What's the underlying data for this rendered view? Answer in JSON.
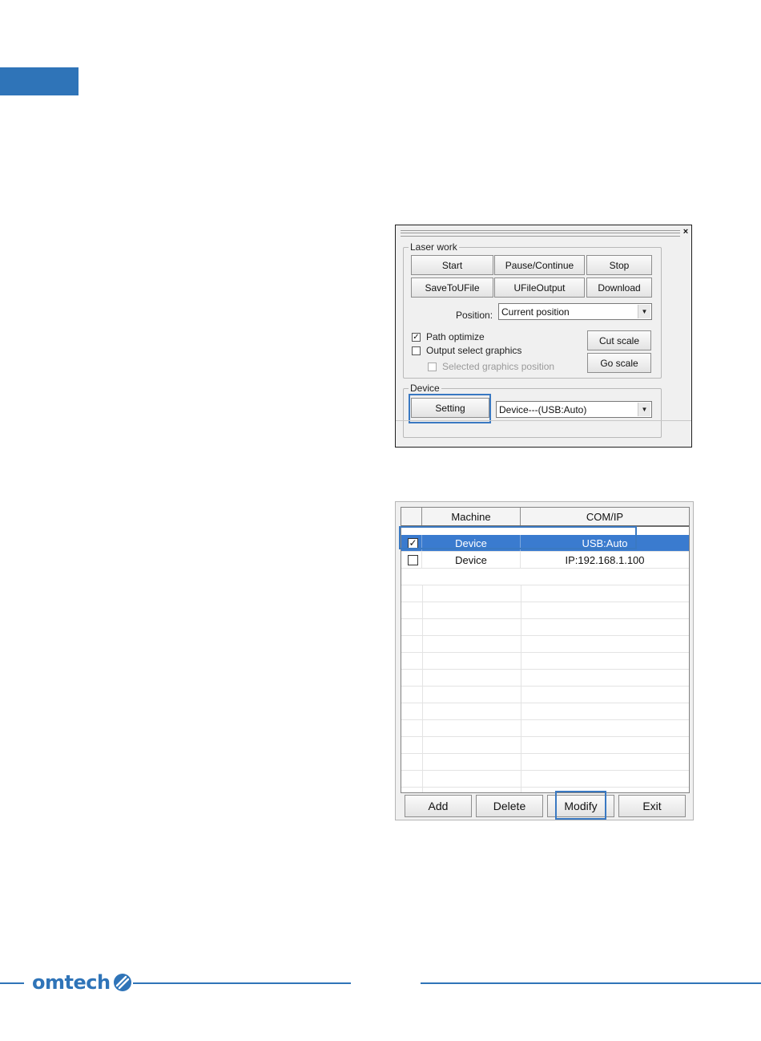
{
  "laser_work": {
    "group_label": "Laser work",
    "close_glyph": "×",
    "buttons": {
      "start": "Start",
      "pause_continue": "Pause/Continue",
      "stop": "Stop",
      "save_to_ufile": "SaveToUFile",
      "ufile_output": "UFileOutput",
      "download": "Download",
      "cut_scale": "Cut scale",
      "go_scale": "Go scale"
    },
    "position_label": "Position:",
    "position_value": "Current position",
    "options": [
      {
        "label": "Path optimize",
        "checked": true,
        "disabled": false
      },
      {
        "label": "Output select graphics",
        "checked": false,
        "disabled": false
      },
      {
        "label": "Selected graphics position",
        "checked": false,
        "disabled": true
      }
    ]
  },
  "device": {
    "group_label": "Device",
    "setting_button": "Setting",
    "device_value": "Device---(USB:Auto)"
  },
  "device_list": {
    "columns": [
      "Machine",
      "COM/IP"
    ],
    "rows": [
      {
        "checked": true,
        "machine": "Device",
        "com_ip": "USB:Auto",
        "selected": true
      },
      {
        "checked": false,
        "machine": "Device",
        "com_ip": "IP:192.168.1.100",
        "selected": false
      }
    ],
    "buttons": {
      "add": "Add",
      "delete": "Delete",
      "modify": "Modify",
      "exit": "Exit"
    }
  },
  "footer": {
    "brand": "omtech"
  },
  "colors": {
    "accent": "#2f74b8",
    "highlight_box": "#3a79c2",
    "selected_row": "#3a7bcf"
  }
}
